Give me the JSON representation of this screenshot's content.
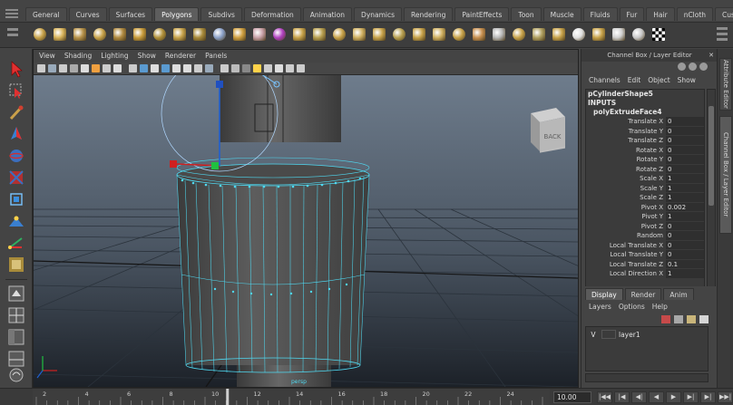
{
  "shelf_tabs": [
    "General",
    "Curves",
    "Surfaces",
    "Polygons",
    "Subdivs",
    "Deformation",
    "Animation",
    "Dynamics",
    "Rendering",
    "PaintEffects",
    "Toon",
    "Muscle",
    "Fluids",
    "Fur",
    "Hair",
    "nCloth",
    "Custom"
  ],
  "active_shelf_tab": "Polygons",
  "shelf_icons": [
    "sphere-icon",
    "cube-icon",
    "cylinder-icon",
    "cone-icon",
    "plane-icon",
    "torus-icon",
    "prism-icon",
    "pipe-icon",
    "helix-icon",
    "combine-icon",
    "separate-icon",
    "extract-icon",
    "smooth-icon",
    "boolean-icon",
    "average-vertices-icon",
    "transfer-icon",
    "fill-hole-icon",
    "triangulate-icon",
    "quadrangulate-icon",
    "extrude-icon",
    "bridge-icon",
    "append-polygon-icon",
    "cut-faces-icon",
    "split-polygon-icon",
    "insert-edge-loop-icon",
    "offset-edge-loop-icon",
    "merge-icon",
    "soften-edge-icon",
    "harden-edge-icon",
    "uv-editor-icon",
    "planar-mapping-icon",
    "checker-icon"
  ],
  "panel_menu": [
    "View",
    "Shading",
    "Lighting",
    "Show",
    "Renderer",
    "Panels"
  ],
  "viewcube_label": "BACK",
  "mesh_label": "persp",
  "channel_box": {
    "title": "Channel Box / Layer Editor",
    "menu": [
      "Channels",
      "Edit",
      "Object",
      "Show"
    ],
    "object_name": "pCylinderShape5",
    "inputs_label": "INPUTS",
    "node_name": "polyExtrudeFace4",
    "attributes": [
      {
        "label": "Translate X",
        "value": "0"
      },
      {
        "label": "Translate Y",
        "value": "0"
      },
      {
        "label": "Translate Z",
        "value": "0"
      },
      {
        "label": "Rotate X",
        "value": "0"
      },
      {
        "label": "Rotate Y",
        "value": "0"
      },
      {
        "label": "Rotate Z",
        "value": "0"
      },
      {
        "label": "Scale X",
        "value": "1"
      },
      {
        "label": "Scale Y",
        "value": "1"
      },
      {
        "label": "Scale Z",
        "value": "1"
      },
      {
        "label": "Pivot X",
        "value": "0.002"
      },
      {
        "label": "Pivot Y",
        "value": "1"
      },
      {
        "label": "Pivot Z",
        "value": "0"
      },
      {
        "label": "Random",
        "value": "0"
      },
      {
        "label": "Local Translate X",
        "value": "0"
      },
      {
        "label": "Local Translate Y",
        "value": "0"
      },
      {
        "label": "Local Translate Z",
        "value": "0.1"
      },
      {
        "label": "Local Direction X",
        "value": "1"
      }
    ]
  },
  "layer_editor": {
    "tabs": [
      "Display",
      "Render",
      "Anim"
    ],
    "active_tab": "Display",
    "menu": [
      "Layers",
      "Options",
      "Help"
    ],
    "layers": [
      {
        "visibility": "V",
        "name": "layer1"
      }
    ]
  },
  "side_tabs": [
    "Attribute Editor",
    "Channel Box / Layer Editor"
  ],
  "time_slider": {
    "ticks": [
      "2",
      "4",
      "6",
      "8",
      "10",
      "12",
      "14",
      "16",
      "18",
      "20",
      "22",
      "24"
    ],
    "current_time": "10.00",
    "controls": [
      "|◀◀",
      "|◀",
      "◀|",
      "◀",
      "▶",
      "▶|",
      "▶|",
      "▶▶|"
    ]
  }
}
